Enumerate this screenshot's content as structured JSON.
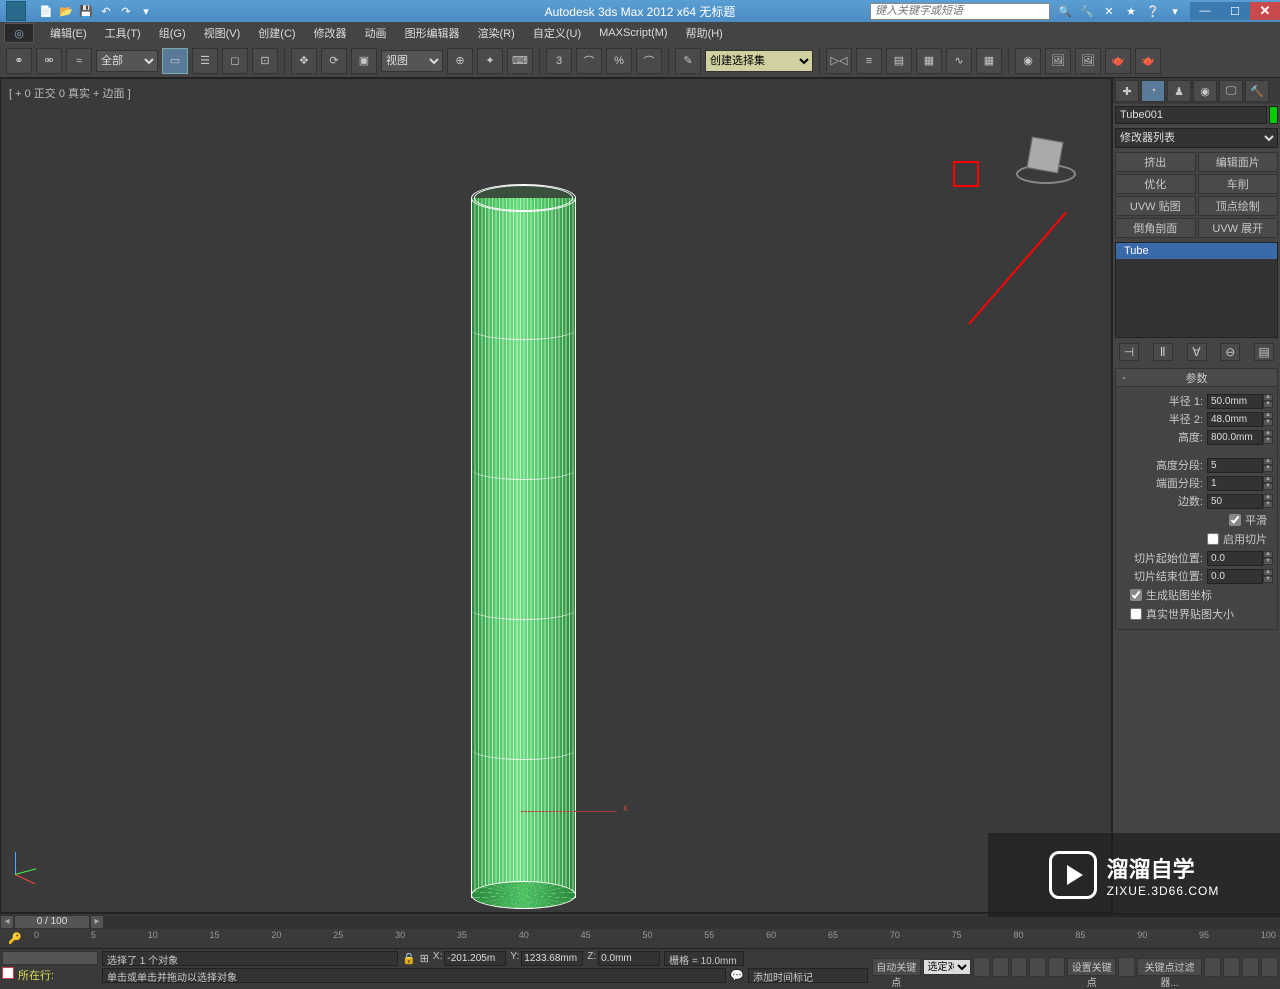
{
  "title": "Autodesk 3ds Max 2012 x64   无标题",
  "search_placeholder": "键入关键字或短语",
  "menus": [
    "编辑(E)",
    "工具(T)",
    "组(G)",
    "视图(V)",
    "创建(C)",
    "修改器",
    "动画",
    "图形编辑器",
    "渲染(R)",
    "自定义(U)",
    "MAXScript(M)",
    "帮助(H)"
  ],
  "toolbar": {
    "sel_all": "全部",
    "view": "视图",
    "selset": "创建选择集"
  },
  "viewport_label": "[ + 0 正交 0 真实 + 边面 ]",
  "timeslider": "0 / 100",
  "ticks": [
    "0",
    "5",
    "10",
    "15",
    "20",
    "25",
    "30",
    "35",
    "40",
    "45",
    "50",
    "55",
    "60",
    "65",
    "70",
    "75",
    "80",
    "85",
    "90",
    "95",
    "100"
  ],
  "panel": {
    "object_name": "Tube001",
    "modifier_list": "修改器列表",
    "buttons": [
      "挤出",
      "编辑面片",
      "优化",
      "车削",
      "UVW 贴图",
      "顶点绘制",
      "倒角剖面",
      "UVW 展开"
    ],
    "stack_item": "Tube",
    "rollout_title": "参数",
    "params": {
      "radius1_label": "半径 1:",
      "radius1": "50.0mm",
      "radius2_label": "半径 2:",
      "radius2": "48.0mm",
      "height_label": "高度:",
      "height": "800.0mm",
      "hseg_label": "高度分段:",
      "hseg": "5",
      "cseg_label": "端面分段:",
      "cseg": "1",
      "sides_label": "边数:",
      "sides": "50",
      "smooth": "平滑",
      "slice_on": "启用切片",
      "slice_from_label": "切片起始位置:",
      "slice_from": "0.0",
      "slice_to_label": "切片结束位置:",
      "slice_to": "0.0",
      "gen_uv": "生成贴图坐标",
      "real_world": "真实世界贴图大小"
    }
  },
  "status": {
    "now_label": "所在行:",
    "sel_count": "选择了 1 个对象",
    "prompt": "单击或单击并拖动以选择对象",
    "x": "-201.205m",
    "y": "1233.68mm",
    "z": "0.0mm",
    "grid": "栅格 = 10.0mm",
    "addtime": "添加时间标记",
    "autokey": "自动关键点",
    "setkey": "设置关键点",
    "keyfilter": "关键点过滤器...",
    "selsel": "选定对"
  },
  "watermark": {
    "brand": "溜溜自学",
    "url": "ZIXUE.3D66.COM"
  }
}
